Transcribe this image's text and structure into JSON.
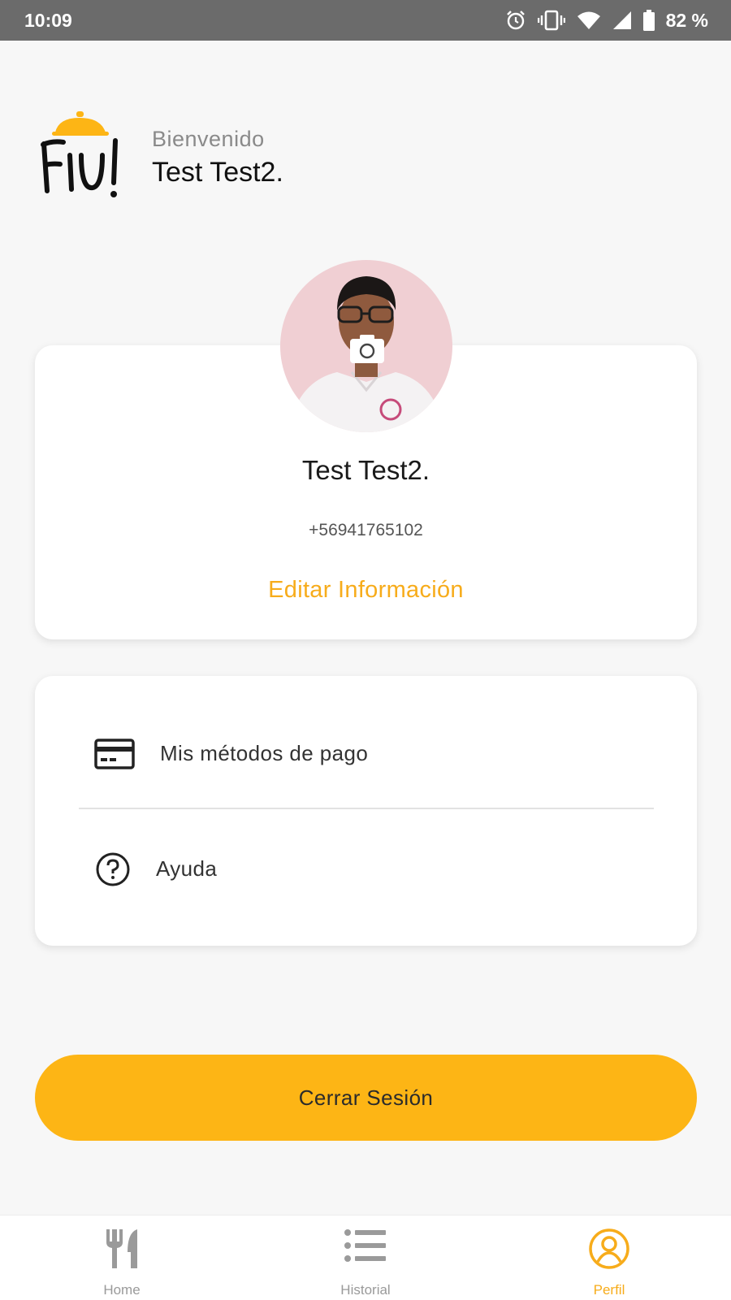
{
  "status_bar": {
    "time": "10:09",
    "battery": "82 %",
    "icons": [
      "alarm-icon",
      "vibrate-icon",
      "wifi-icon",
      "signal-icon",
      "battery-icon"
    ]
  },
  "header": {
    "logo_text": "FIU!",
    "welcome": "Bienvenido",
    "user_name": "Test Test2."
  },
  "profile": {
    "name": "Test Test2.",
    "phone": "+56941765102",
    "edit_label": "Editar Información"
  },
  "menu": {
    "items": [
      {
        "label": "Mis métodos de pago",
        "icon": "credit-card-icon"
      },
      {
        "label": "Ayuda",
        "icon": "help-circle-icon"
      }
    ]
  },
  "logout_label": "Cerrar Sesión",
  "bottom_nav": {
    "items": [
      {
        "label": "Home",
        "icon": "utensils-icon",
        "active": false
      },
      {
        "label": "Historial",
        "icon": "list-icon",
        "active": false
      },
      {
        "label": "Perfil",
        "icon": "user-circle-icon",
        "active": true
      }
    ]
  },
  "colors": {
    "accent": "#fdb515",
    "accent_text": "#f7ac1b",
    "background": "#f7f7f7",
    "status_bar": "#6b6b6b"
  }
}
